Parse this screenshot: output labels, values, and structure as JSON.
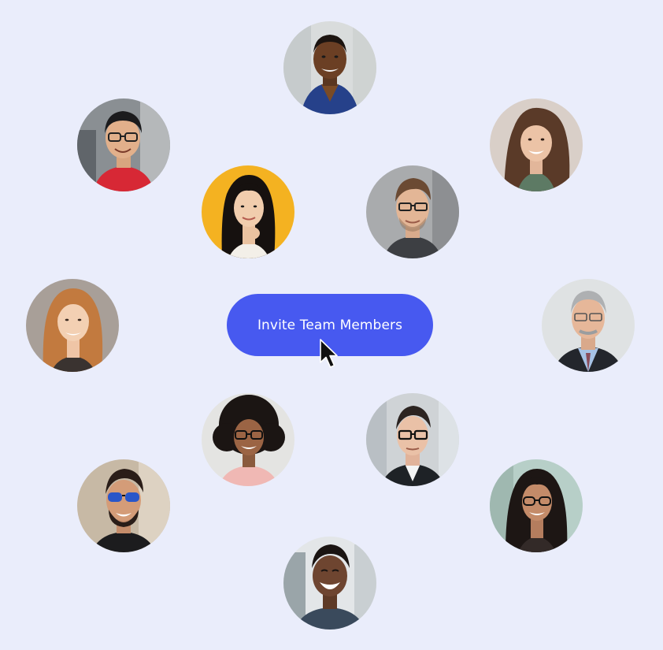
{
  "invite_button": {
    "label": "Invite Team Members",
    "color": "#4759f0",
    "text_color": "#ffffff"
  },
  "page": {
    "background": "#eaedfb"
  },
  "cursor": {
    "icon": "arrow-pointer-icon"
  }
}
